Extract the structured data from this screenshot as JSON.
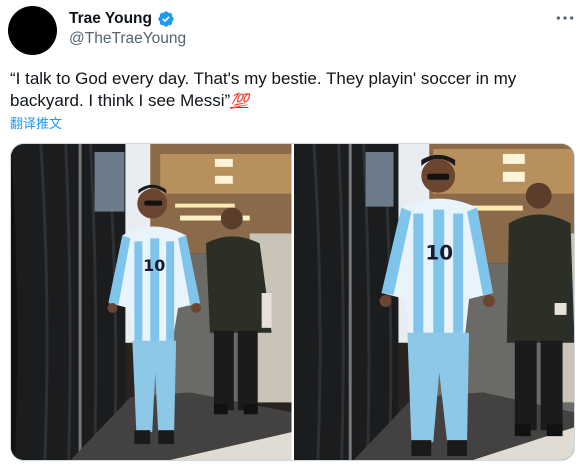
{
  "author": {
    "display_name": "Trae Young",
    "handle": "@TheTraeYoung",
    "verified": true,
    "avatar_color": "#000000"
  },
  "tweet": {
    "text": "“I talk to God every day. That's my bestie. They playin' soccer in my backyard. I think I see Messi”",
    "emoji": "💯",
    "translate_label": "翻译推文"
  },
  "media": {
    "photos": [
      {
        "jersey_number": "10"
      },
      {
        "jersey_number": "10"
      }
    ]
  },
  "colors": {
    "accent": "#1d9bf0",
    "text": "#0f1419",
    "secondary": "#536471"
  },
  "icons": {
    "verified": "verified-badge-icon",
    "more": "more-options-icon"
  }
}
